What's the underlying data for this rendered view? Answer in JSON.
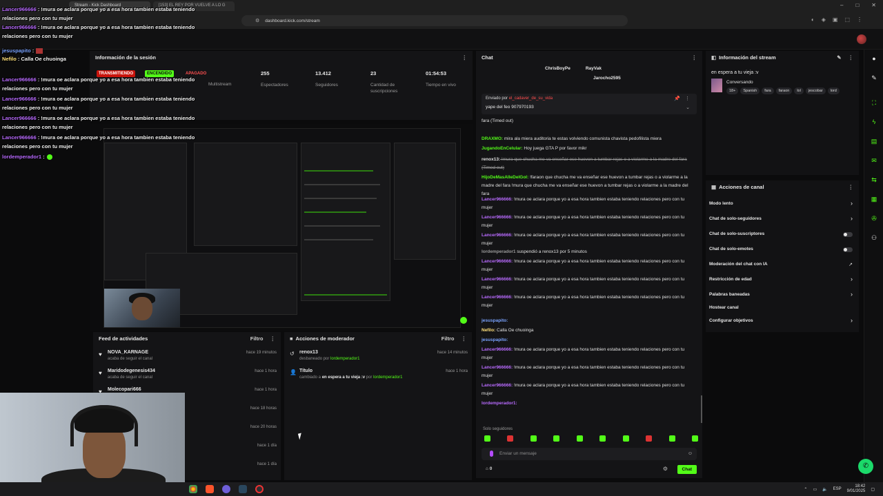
{
  "browser": {
    "tabs": [
      "Stream - Kick Dashboard",
      "[153] EL REY POR VUELVE A LO G"
    ],
    "url": "dashboard.kick.com/stream"
  },
  "session": {
    "title": "Información de la sesión",
    "status_transmitting": "TRANSMITIENDO",
    "status_on": "ENCENDIDO",
    "status_off": "APAGADO",
    "multistream_label": "Multistream",
    "stats": [
      {
        "value": "255",
        "label": "Espectadores"
      },
      {
        "value": "13.412",
        "label": "Seguidores"
      },
      {
        "value": "23",
        "label": "Cantidad de suscripciones"
      },
      {
        "value": "01:54:53",
        "label": "Tiempo en vivo"
      }
    ]
  },
  "feed": {
    "title": "Feed de actividades",
    "filter": "Filtro",
    "items": [
      {
        "name": "NOVA_KARNAGE",
        "sub": "acaba de seguir el canal",
        "time": "hace 19 minutos"
      },
      {
        "name": "Maridodegenesis434",
        "sub": "acaba de seguir el canal",
        "time": "hace 1 hora"
      },
      {
        "name": "Molecopari666",
        "sub": "",
        "time": "hace 1 hora"
      },
      {
        "name": "",
        "sub": "",
        "time": "hace 18 horas"
      },
      {
        "name": "",
        "sub": "",
        "time": "hace 20 horas"
      },
      {
        "name": "",
        "sub": "",
        "time": "hace 1 día"
      },
      {
        "name": "",
        "sub": "",
        "time": "hace 1 día"
      }
    ]
  },
  "mod_actions": {
    "title": "Acciones de moderador",
    "filter": "Filtro",
    "items": [
      {
        "title": "renox13",
        "sub_a": "desbaneado por ",
        "sub_b": "lordemperador1",
        "time": "hace 14 minutos"
      },
      {
        "title": "Título",
        "sub_a": "cambiado a ",
        "sub_b": "en espera a tu vieja :v",
        "sub_c": " por ",
        "sub_d": "lordemperador1",
        "time": "hace 1 hora"
      }
    ]
  },
  "chat": {
    "title": "Chat",
    "pinned_users": [
      "ChrisBoyPe",
      "RayVak",
      "Jarocho2595"
    ],
    "sent_by_label": "Enviado por ",
    "sent_by_user": "el_cadaver_de_su_vida",
    "sent_message": "yape del feo 907970193",
    "messages": [
      {
        "user": "",
        "text": "fara (Timed out)",
        "color": "#9a9a9a"
      },
      {
        "user": "DRAXMO:",
        "text": " mira ala miera auditoria te estas volviendo comunista chavista pedofilista miera",
        "color": "#53fc18"
      },
      {
        "user": "JugandoEnCelular:",
        "text": " Hoy juega GTA P por favor mikr",
        "color": "#53fc18"
      },
      {
        "user": "renox13:",
        "text": " Imura que chucha me va enseñar ese huevon a tumbar rejas o a violarme a la madre del fara (Timed out)",
        "color": "#e0e0e0",
        "struck": true
      },
      {
        "user": "HijoDeMasAlleDelGol:",
        "text": " !faraon que chucha me va enseñar ese huevon a tumbar rejas o a violarme a la madre del fara !mura que chucha me va enseñar ese huevon a tumbar rejas o a violarme a la madre del fara",
        "color": "#53fc18"
      },
      {
        "user": "Lancer966666:",
        "text": " !mura oe aclara porque yo a esa hora tambien estaba teniendo relaciones pero con tu mujer",
        "color": "#b96bff"
      },
      {
        "user": "Lancer966666:",
        "text": " !mura oe aclara porque yo a esa hora tambien estaba teniendo relaciones pero con tu mujer",
        "color": "#b96bff"
      },
      {
        "user": "Lancer966666:",
        "text": " !mura oe aclara porque yo a esa hora tambien estaba teniendo relaciones pero con tu mujer",
        "color": "#b96bff"
      },
      {
        "user": "lordemperador1",
        "text": " suspendió a renox13 por 5 minutos",
        "color": "#9a9a9a"
      },
      {
        "user": "Lancer966666:",
        "text": " !mura oe aclara porque yo a esa hora tambien estaba teniendo relaciones pero con tu mujer",
        "color": "#b96bff"
      },
      {
        "user": "Lancer966666:",
        "text": " !mura oe aclara porque yo a esa hora tambien estaba teniendo relaciones pero con tu mujer",
        "color": "#b96bff"
      },
      {
        "user": "Lancer966666:",
        "text": " !mura oe aclara porque yo a esa hora tambien estaba teniendo relaciones pero con tu mujer",
        "color": "#b96bff"
      },
      {
        "user": "jesuspapito:",
        "text": "",
        "color": "#7aa3ff"
      },
      {
        "user": "Nefilo:",
        "text": " Calla Oe chuoinga",
        "color": "#ffe07a"
      },
      {
        "user": "jesuspapito:",
        "text": "",
        "color": "#7aa3ff"
      },
      {
        "user": "Lancer966666:",
        "text": " !mura oe aclara porque yo a esa hora tambien estaba teniendo relaciones pero con tu mujer",
        "color": "#b96bff"
      },
      {
        "user": "Lancer966666:",
        "text": " !mura oe aclara porque yo a esa hora tambien estaba teniendo relaciones pero con tu mujer",
        "color": "#b96bff"
      },
      {
        "user": "Lancer966666:",
        "text": " !mura oe aclara porque yo a esa hora tambien estaba teniendo relaciones pero con tu mujer",
        "color": "#b96bff"
      },
      {
        "user": "lordemperador1:",
        "text": "",
        "color": "#b96bff"
      }
    ],
    "followers_only": "Solo seguidores",
    "input_placeholder": "Enviar un mensaje",
    "user_count": "0",
    "send_button": "Chat"
  },
  "stream_info": {
    "title": "Información del stream",
    "stream_title": "en espera a tu vieja :v",
    "category": "Conversando",
    "tags": [
      "18+",
      "Spanish",
      "fara",
      "faraon",
      "lol",
      "jescobar",
      "lord"
    ]
  },
  "channel_actions": {
    "title": "Acciones de canal",
    "items": [
      {
        "label": "Modo lento",
        "control": "chevron"
      },
      {
        "label": "Chat de solo-seguidores",
        "control": "chevron"
      },
      {
        "label": "Chat de solo-suscriptores",
        "control": "toggle"
      },
      {
        "label": "Chat de solo-emotes",
        "control": "toggle"
      },
      {
        "label": "Moderación del chat con IA",
        "control": "external"
      },
      {
        "label": "Restricción de edad",
        "control": "chevron"
      },
      {
        "label": "Palabras baneadas",
        "control": "chevron"
      },
      {
        "label": "Hostear canal",
        "control": "none"
      },
      {
        "label": "Configurar objetivos",
        "control": "chevron"
      }
    ]
  },
  "overlay": {
    "lines": [
      {
        "user": "Lancer966666",
        "text": " : !mura oe aclara porque yo a esa hora tambien estaba teniendo relaciones pero con tu mujer",
        "cls": "u2"
      },
      {
        "user": "Lancer966666",
        "text": " : !mura oe aclara porque yo a esa hora tambien estaba teniendo relaciones pero con tu mujer",
        "cls": "u2"
      },
      {
        "user": "jesuspapito",
        "text": " :",
        "cls": "u"
      },
      {
        "user": "Nefilo",
        "text": " : Calla Oe chuoinga",
        "cls": "y"
      },
      {
        "user": "Lancer966666",
        "text": " : !mura oe aclara porque yo a esa hora tambien estaba teniendo relaciones pero con tu mujer",
        "cls": "u2"
      },
      {
        "user": "Lancer966666",
        "text": " : !mura oe aclara porque yo a esa hora tambien estaba teniendo relaciones pero con tu mujer",
        "cls": "u2"
      },
      {
        "user": "Lancer966666",
        "text": " : !mura oe aclara porque yo a esa hora tambien estaba teniendo relaciones pero con tu mujer",
        "cls": "u2"
      },
      {
        "user": "Lancer966666",
        "text": " : !mura oe aclara porque yo a esa hora tambien estaba teniendo relaciones pero con tu mujer",
        "cls": "u2"
      },
      {
        "user": "lordemperador1",
        "text": " :",
        "cls": "u2"
      }
    ]
  },
  "taskbar": {
    "lang": "ESP",
    "time": "18:42",
    "date": "9/01/2025"
  }
}
